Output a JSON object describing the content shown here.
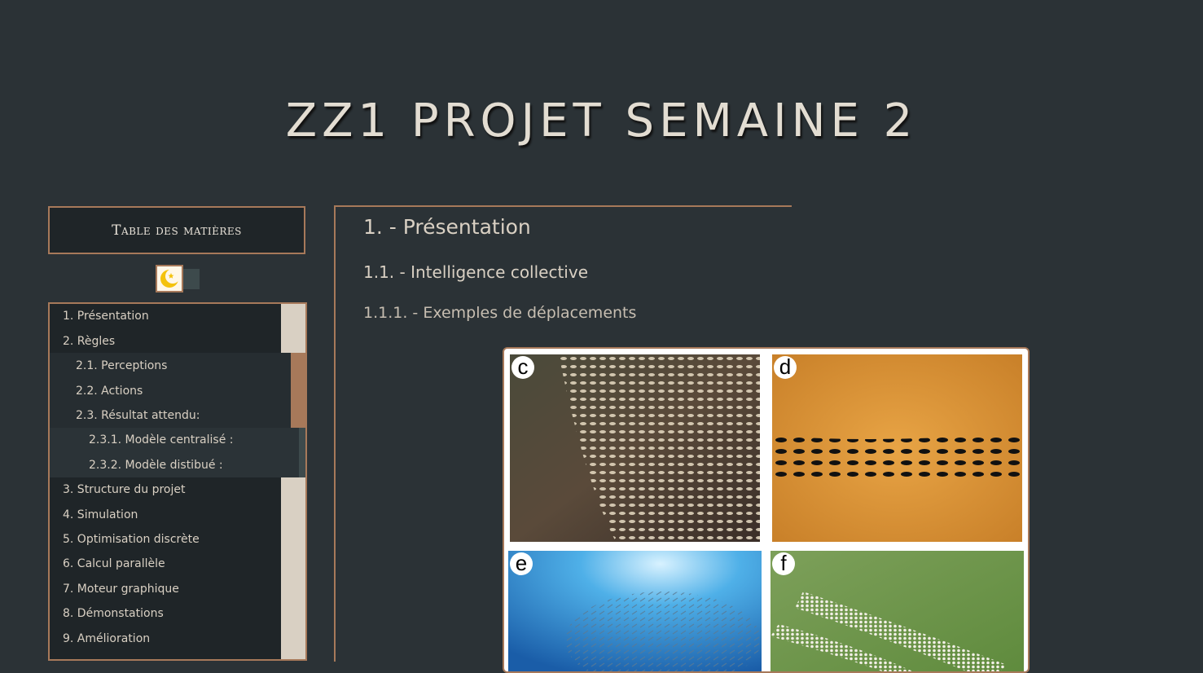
{
  "site": {
    "title": "ZZ1 PROJET SEMAINE 2"
  },
  "sidebar": {
    "toc_title": "Table des matières",
    "theme_toggle_icon": "moon-star-icon",
    "items": [
      {
        "label": "1. Présentation",
        "level": 1
      },
      {
        "label": "2. Règles",
        "level": 1
      },
      {
        "label": "2.1. Perceptions",
        "level": 2
      },
      {
        "label": "2.2. Actions",
        "level": 2
      },
      {
        "label": "2.3. Résultat attendu:",
        "level": 2
      },
      {
        "label": "2.3.1. Modèle centralisé :",
        "level": 3
      },
      {
        "label": "2.3.2. Modèle distibué :",
        "level": 3
      },
      {
        "label": "3. Structure du projet",
        "level": 1
      },
      {
        "label": "4. Simulation",
        "level": 1
      },
      {
        "label": "5. Optimisation discrète",
        "level": 1
      },
      {
        "label": "6. Calcul parallèle",
        "level": 1
      },
      {
        "label": "7. Moteur graphique",
        "level": 1
      },
      {
        "label": "8. Démonstations",
        "level": 1
      },
      {
        "label": "9. Amélioration",
        "level": 1
      }
    ]
  },
  "main": {
    "heading1": "1. - Présentation",
    "heading2": "1.1. - Intelligence collective",
    "heading3": "1.1.1. - Exemples de déplacements",
    "figure": {
      "panels": [
        {
          "label": "c"
        },
        {
          "label": "d"
        },
        {
          "label": "e"
        },
        {
          "label": "f"
        }
      ]
    }
  },
  "colors": {
    "background": "#2b3236",
    "accent": "#a7795a",
    "text": "#d9d0c3"
  }
}
